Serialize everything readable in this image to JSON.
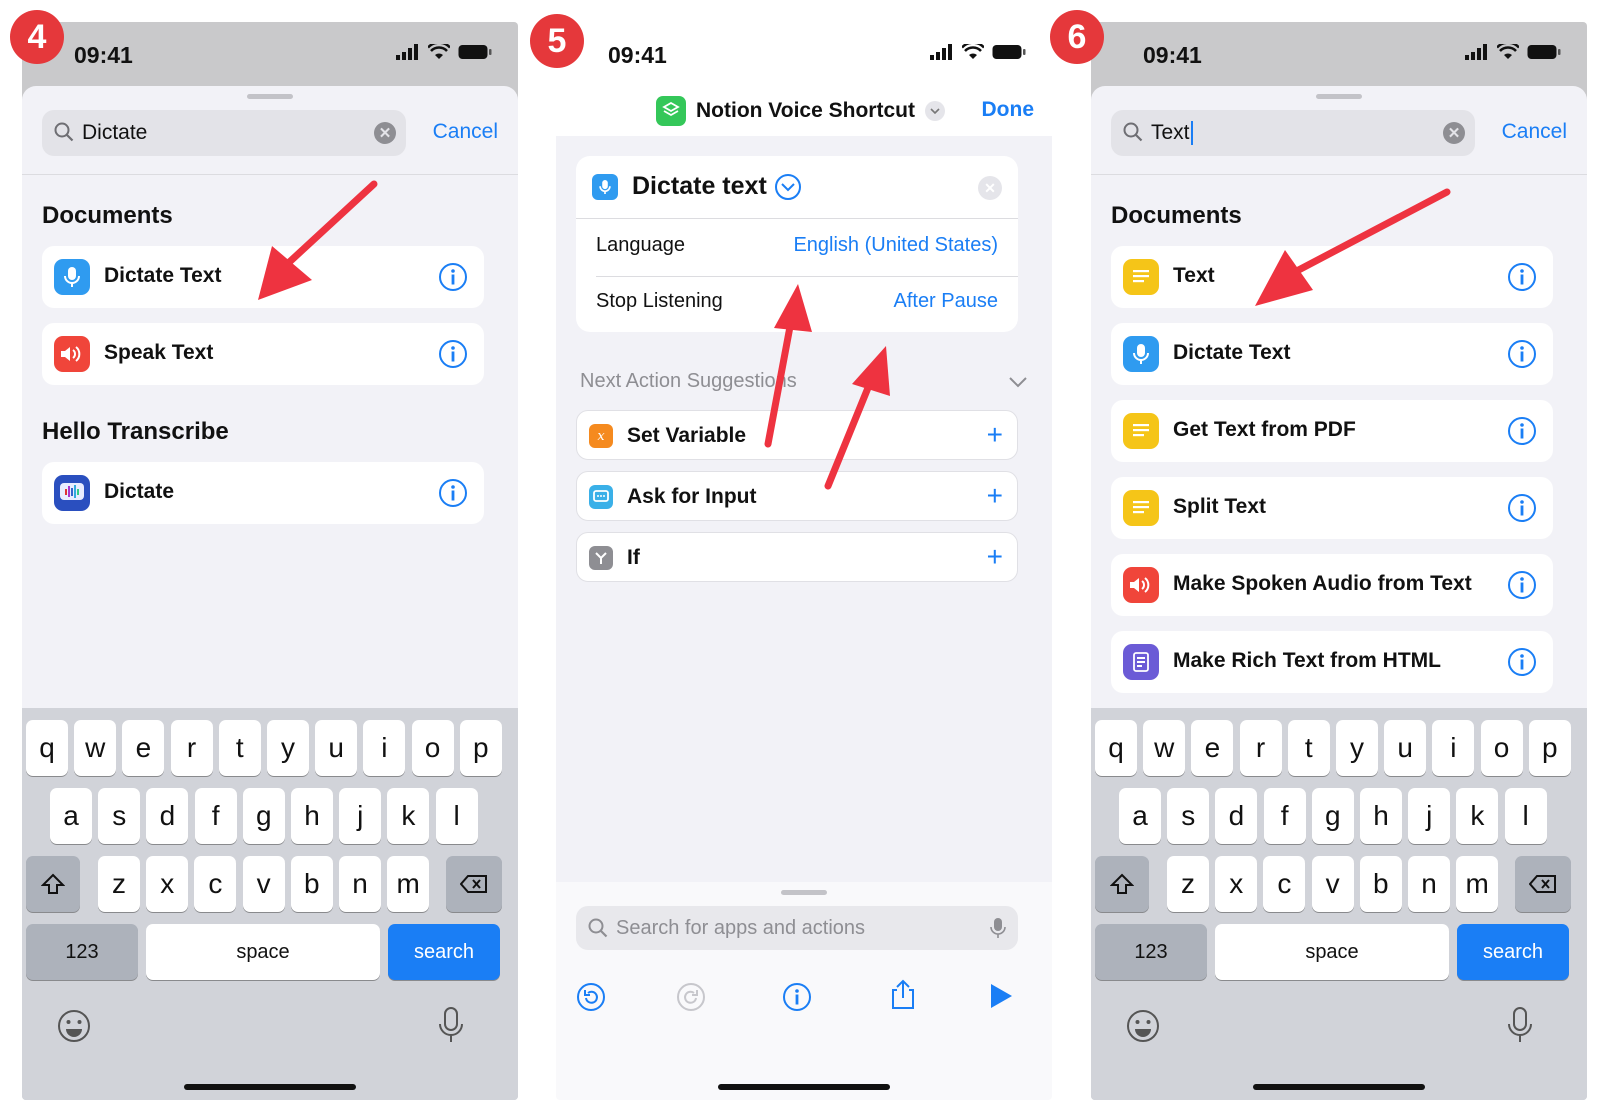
{
  "status": {
    "time": "09:41"
  },
  "panel1": {
    "badge": "4",
    "search": {
      "value": "Dictate",
      "cancel": "Cancel"
    },
    "sections": [
      {
        "title": "Documents",
        "items": [
          {
            "label": "Dictate Text",
            "icon": "microphone-icon",
            "color": "#2f9bf0"
          },
          {
            "label": "Speak Text",
            "icon": "speaker-icon",
            "color": "#f0453a"
          }
        ]
      },
      {
        "title": "Hello Transcribe",
        "items": [
          {
            "label": "Dictate",
            "icon": "hello-transcribe-app-icon",
            "color": "#2a4fbf"
          }
        ]
      }
    ]
  },
  "panel2": {
    "badge": "5",
    "shortcut_name": "Notion Voice Shortcut",
    "done": "Done",
    "action": {
      "title": "Dictate text",
      "params": [
        {
          "label": "Language",
          "value": "English (United States)"
        },
        {
          "label": "Stop Listening",
          "value": "After Pause"
        }
      ]
    },
    "suggestions_title": "Next Action Suggestions",
    "suggestions": [
      {
        "label": "Set Variable",
        "icon": "variable-icon",
        "color": "#f58a1f"
      },
      {
        "label": "Ask for Input",
        "icon": "ask-input-icon",
        "color": "#3ab0e8"
      },
      {
        "label": "If",
        "icon": "if-icon",
        "color": "#8e8e93"
      }
    ],
    "search_placeholder": "Search for apps and actions"
  },
  "panel3": {
    "badge": "6",
    "search": {
      "value": "Text",
      "cancel": "Cancel"
    },
    "sections": [
      {
        "title": "Documents",
        "items": [
          {
            "label": "Text",
            "icon": "text-icon",
            "color": "#f5c518"
          },
          {
            "label": "Dictate Text",
            "icon": "microphone-icon",
            "color": "#2f9bf0"
          },
          {
            "label": "Get Text from PDF",
            "icon": "text-icon",
            "color": "#f5c518"
          },
          {
            "label": "Split Text",
            "icon": "text-icon",
            "color": "#f5c518"
          },
          {
            "label": "Make Spoken Audio from Text",
            "icon": "speaker-icon",
            "color": "#f0453a"
          },
          {
            "label": "Make Rich Text from HTML",
            "icon": "rich-text-icon",
            "color": "#6b5bd6"
          }
        ]
      }
    ]
  },
  "keyboard": {
    "row1": [
      "q",
      "w",
      "e",
      "r",
      "t",
      "y",
      "u",
      "i",
      "o",
      "p"
    ],
    "row2": [
      "a",
      "s",
      "d",
      "f",
      "g",
      "h",
      "j",
      "k",
      "l"
    ],
    "row3": [
      "z",
      "x",
      "c",
      "v",
      "b",
      "n",
      "m"
    ],
    "numbers": "123",
    "space": "space",
    "action": "search"
  },
  "colors": {
    "accent": "#1a7ef5",
    "badge": "#e5383b",
    "arrow": "#ee3340"
  }
}
